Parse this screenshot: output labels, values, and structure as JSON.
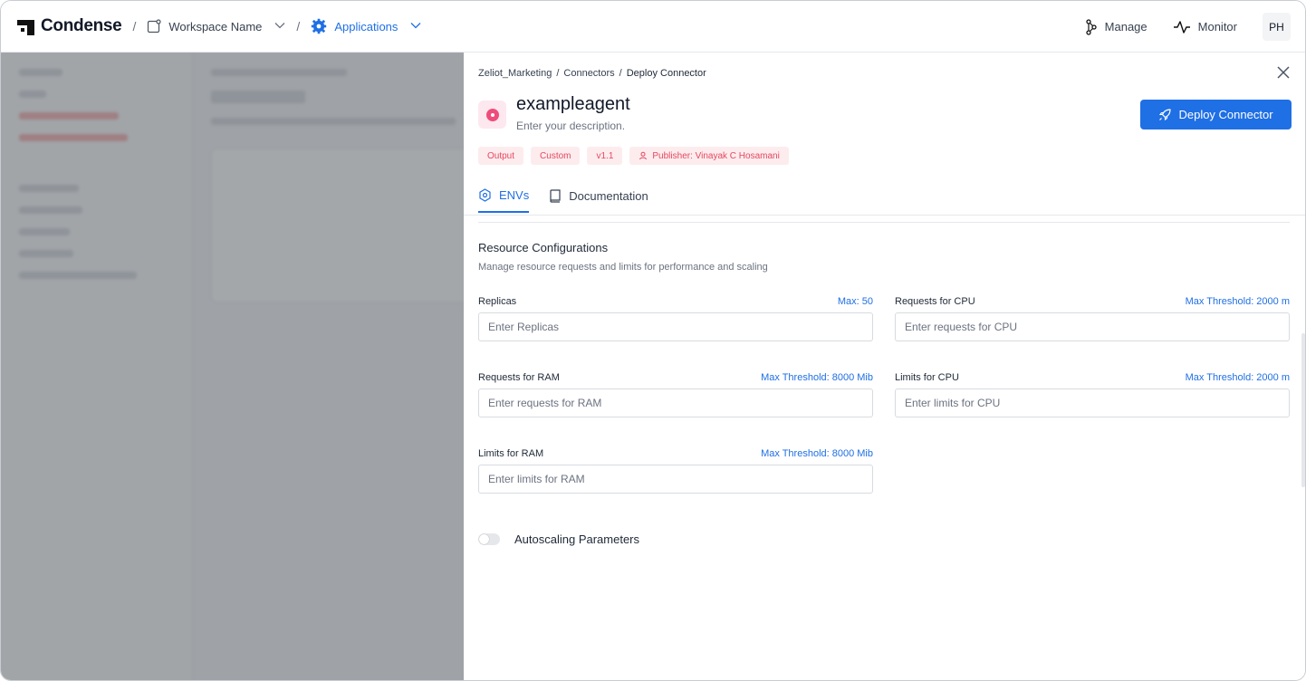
{
  "topbar": {
    "brand": "Condense",
    "separator": "/",
    "workspace": "Workspace Name",
    "applications": "Applications",
    "manage": "Manage",
    "monitor": "Monitor",
    "avatar": "PH"
  },
  "drawer": {
    "breadcrumb": [
      "Zeliot_Marketing",
      "Connectors",
      "Deploy Connector"
    ],
    "crumb_sep": "/",
    "agent_name": "exampleagent",
    "agent_description": "Enter your description.",
    "deploy_button": "Deploy Connector",
    "tags": [
      "Output",
      "Custom",
      "v1.1",
      "Publisher: Vinayak C Hosamani"
    ],
    "tabs": [
      "ENVs",
      "Documentation"
    ],
    "active_tab": "ENVs",
    "section_title": "Resource Configurations",
    "section_subtitle": "Manage resource requests and limits for performance and scaling",
    "fields": {
      "replicas": {
        "label": "Replicas",
        "hint": "Max: 50",
        "placeholder": "Enter Replicas"
      },
      "requests_cpu": {
        "label": "Requests for CPU",
        "hint": "Max Threshold: 2000 m",
        "placeholder": "Enter requests for CPU"
      },
      "requests_ram": {
        "label": "Requests for RAM",
        "hint": "Max Threshold: 8000 Mib",
        "placeholder": "Enter requests for RAM"
      },
      "limits_cpu": {
        "label": "Limits for CPU",
        "hint": "Max Threshold: 2000 m",
        "placeholder": "Enter limits for CPU"
      },
      "limits_ram": {
        "label": "Limits for RAM",
        "hint": "Max Threshold: 8000 Mib",
        "placeholder": "Enter limits for RAM"
      }
    },
    "autoscaling_label": "Autoscaling Parameters",
    "autoscaling_enabled": false
  },
  "colors": {
    "accent": "#1f6fe5",
    "tag_bg": "#fdecee",
    "tag_text": "#e5485f",
    "agent_icon": "#ee4d7b"
  }
}
